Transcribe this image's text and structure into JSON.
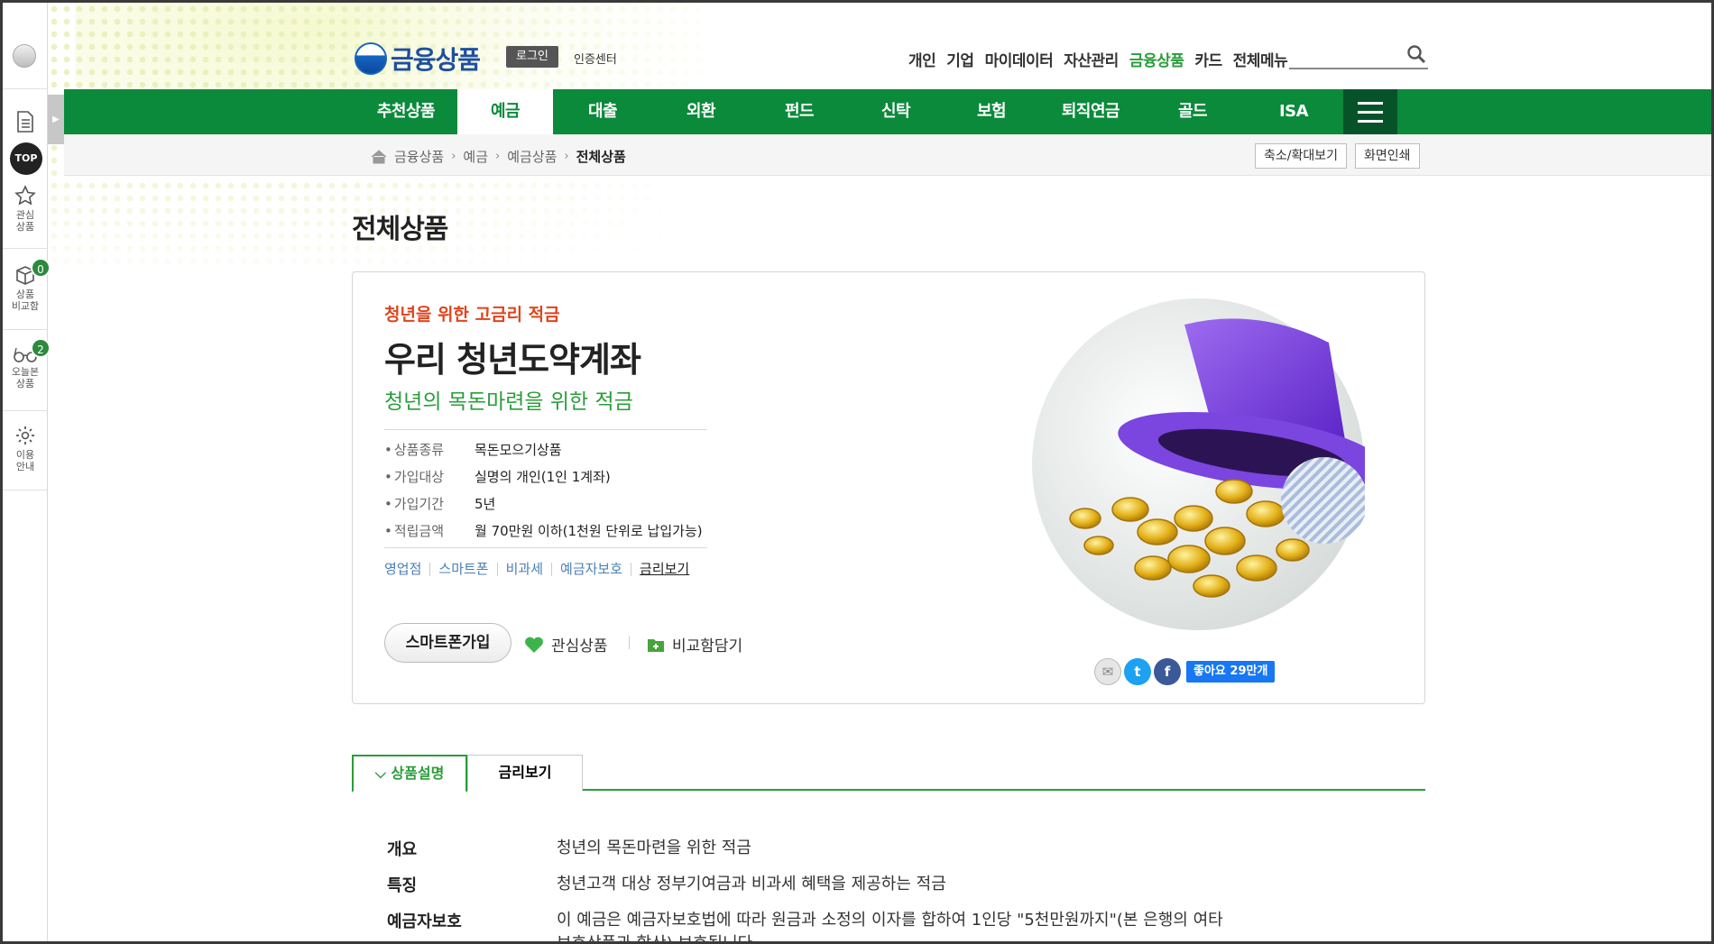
{
  "quickbar": {
    "items": [
      {
        "label": "",
        "icon": "document-icon"
      },
      {
        "label": "관심\n상품",
        "icon": "star-icon"
      },
      {
        "label": "상품\n비교함",
        "icon": "box-icon",
        "badge": "0"
      },
      {
        "label": "오늘본\n상품",
        "icon": "glasses-icon",
        "badge": "2"
      },
      {
        "label": "이용\n안내",
        "icon": "gear-icon"
      }
    ],
    "top_label": "TOP"
  },
  "header": {
    "logo_text": "금융상품",
    "login_label": "로그인",
    "cert_label": "인증센터",
    "topnav": [
      "개인",
      "기업",
      "마이데이터",
      "자산관리",
      "금융상품",
      "카드",
      "전체메뉴"
    ],
    "topnav_active": "금융상품",
    "search_placeholder": ""
  },
  "gnb": {
    "items": [
      "추천상품",
      "예금",
      "대출",
      "외환",
      "펀드",
      "신탁",
      "보험",
      "퇴직연금",
      "골드",
      "ISA"
    ],
    "active": "예금"
  },
  "breadcrumb": {
    "items": [
      "금융상품",
      "예금",
      "예금상품",
      "전체상품"
    ],
    "zoom_label": "축소/확대보기",
    "print_label": "화면인쇄"
  },
  "page_title": "전체상품",
  "product": {
    "tagline": "청년을 위한 고금리 적금",
    "name": "우리 청년도약계좌",
    "desc": "청년의 목돈마련을 위한 적금",
    "info": [
      {
        "key": "상품종류",
        "value": "목돈모으기상품"
      },
      {
        "key": "가입대상",
        "value": "실명의 개인(1인 1계좌)"
      },
      {
        "key": "가입기간",
        "value": "5년"
      },
      {
        "key": "적립금액",
        "value": "월 70만원 이하(1천원 단위로 납입가능)"
      }
    ],
    "tags": [
      "영업점",
      "스마트폰",
      "비과세",
      "예금자보호",
      "금리보기"
    ],
    "smart_join_label": "스마트폰가입",
    "favorite_label": "관심상품",
    "compare_label": "비교함담기",
    "fb_like_label": "좋아요 29만개"
  },
  "tabs": [
    "상품설명",
    "금리보기"
  ],
  "description": [
    {
      "key": "개요",
      "value": "청년의 목돈마련을 위한 적금"
    },
    {
      "key": "특징",
      "value": "청년고객 대상 정부기여금과 비과세 혜택을 제공하는 적금"
    },
    {
      "key": "예금자보호",
      "value": "이 예금은 예금자보호법에 따라 원금과 소정의 이자를 합하여 1인당 \"5천만원까지\"(본 은행의 여타 보호상품과 합산) 보호됩니다."
    }
  ],
  "colors": {
    "brand_green": "#0a8a3a",
    "accent_orange": "#e0441d",
    "brand_blue": "#1e4fa0"
  }
}
